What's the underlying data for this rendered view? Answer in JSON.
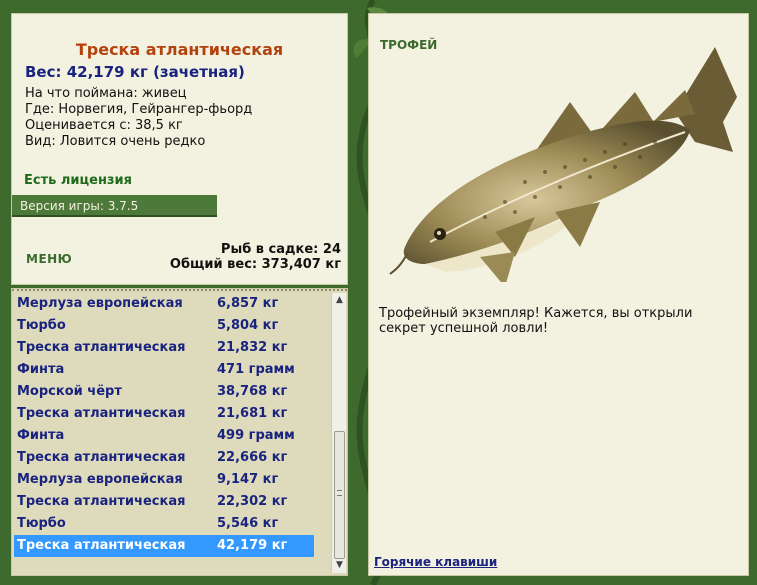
{
  "fish": {
    "title": "Треска атлантическая",
    "weight": "Вес: 42,179 кг (зачетная)",
    "caught_on": "На что поймана: живец",
    "where": "Где: Норвегия, Гейрангер-фьорд",
    "valued_from": "Оценивается с: 38,5 кг",
    "kind": "Вид: Ловится очень редко"
  },
  "license": "Есть лицензия",
  "version": "Версия игры: 3.7.5",
  "menu_label": "МЕНЮ",
  "cage": {
    "count": "Рыб в садке: 24",
    "total": "Общий вес: 373,407 кг"
  },
  "catch_list": [
    {
      "name": "Мерлуза европейская",
      "weight": "6,857 кг"
    },
    {
      "name": "Тюрбо",
      "weight": "5,804 кг"
    },
    {
      "name": "Треска атлантическая",
      "weight": "21,832 кг"
    },
    {
      "name": "Финта",
      "weight": "471 грамм"
    },
    {
      "name": "Морской чёрт",
      "weight": "38,768 кг"
    },
    {
      "name": "Треска атлантическая",
      "weight": "21,681 кг"
    },
    {
      "name": "Финта",
      "weight": "499 грамм"
    },
    {
      "name": "Треска атлантическая",
      "weight": "22,666 кг"
    },
    {
      "name": "Мерлуза европейская",
      "weight": "9,147 кг"
    },
    {
      "name": "Треска атлантическая",
      "weight": "22,302 кг"
    },
    {
      "name": "Тюрбо",
      "weight": "5,546 кг"
    },
    {
      "name": "Треска атлантическая",
      "weight": "42,179 кг"
    }
  ],
  "selected_index": 11,
  "trophy": {
    "label": "ТРОФЕЙ",
    "text": "Трофейный экземпляр! Кажется, вы открыли секрет успешной ловли!"
  },
  "hotkeys": "Горячие клавиши",
  "colors": {
    "frame_green": "#3f6a2e",
    "panel_bg": "#f3f1e0",
    "list_bg": "#dedbbd",
    "selection_blue": "#3399ff",
    "title_orange": "#b4420e",
    "text_navy": "#1a237e"
  }
}
